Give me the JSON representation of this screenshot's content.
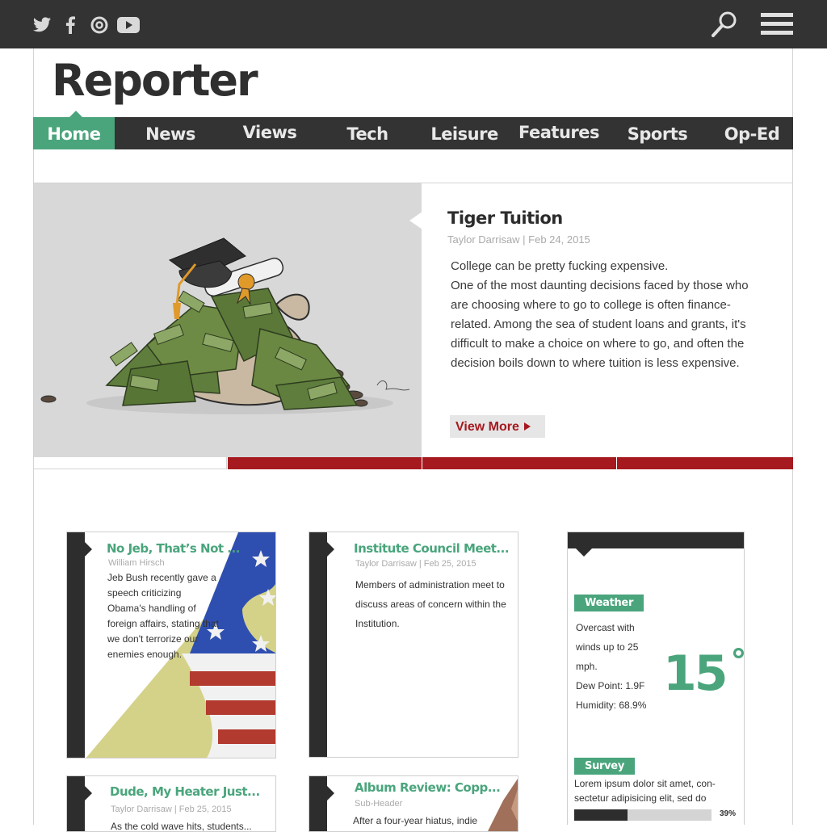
{
  "topbar": {
    "social": [
      "twitter-icon",
      "facebook-icon",
      "instagram-icon",
      "youtube-icon"
    ],
    "search": "search-icon",
    "menu": "menu-icon",
    "bg_color": "#333333"
  },
  "site": {
    "title": "Reporter"
  },
  "nav": {
    "items": [
      {
        "label": "Home",
        "active": true
      },
      {
        "label": "News"
      },
      {
        "label": "Views"
      },
      {
        "label": "Tech"
      },
      {
        "label": "Leisure"
      },
      {
        "label": "Features"
      },
      {
        "label": "Sports"
      },
      {
        "label": "Op-Ed"
      }
    ],
    "accent_color": "#4aa57c"
  },
  "hero": {
    "title": "Tiger Tuition",
    "meta": "Taylor Darrisaw | Feb 24, 2015",
    "body": [
      "College can be pretty fucking expensive.",
      "One of the most daunting decisions faced by those who are choosing where to go to college is often finance-related. Among the sea of student loans and grants, it's difficult to make a choice on where to go, and often the decision boils down to where tuition is less expensive."
    ],
    "cta": "View More",
    "slider": {
      "count": 4,
      "active_index": 0,
      "active_color": "#a5191f"
    }
  },
  "cards": [
    {
      "title": "No Jeb, That’s Not ...",
      "author": "William Hirsch",
      "body": "Jeb Bush recently gave a speech criticizing Obama's handling of foreign affairs, stating that we don't terrorize our enemies enough."
    },
    {
      "title": "Institute Council Meet...",
      "author": "Taylor Darrisaw | Feb 25, 2015",
      "body": "Members of administration meet to discuss areas of concern within the Institution."
    },
    {
      "title": "Dude, My Heater Just...",
      "author": "Taylor Darrisaw | Feb 25, 2015",
      "body": "As the cold wave hits, students..."
    },
    {
      "title": "Album Review: Copp...",
      "author": "Sub-Header",
      "body": "After a four-year hiatus, indie"
    }
  ],
  "weather": {
    "tag": "Weather",
    "conditions": [
      "Overcast with",
      "winds up to 25",
      "mph."
    ],
    "dew_point": "Dew Point: 1.9F",
    "humidity": "Humidity: 68.9%",
    "temperature": "15",
    "degree": "°"
  },
  "survey": {
    "tag": "Survey",
    "question": "Lorem ipsum dolor sit amet, con- sectetur adipisicing elit, sed do",
    "percent": 39,
    "percent_label": "39%"
  }
}
